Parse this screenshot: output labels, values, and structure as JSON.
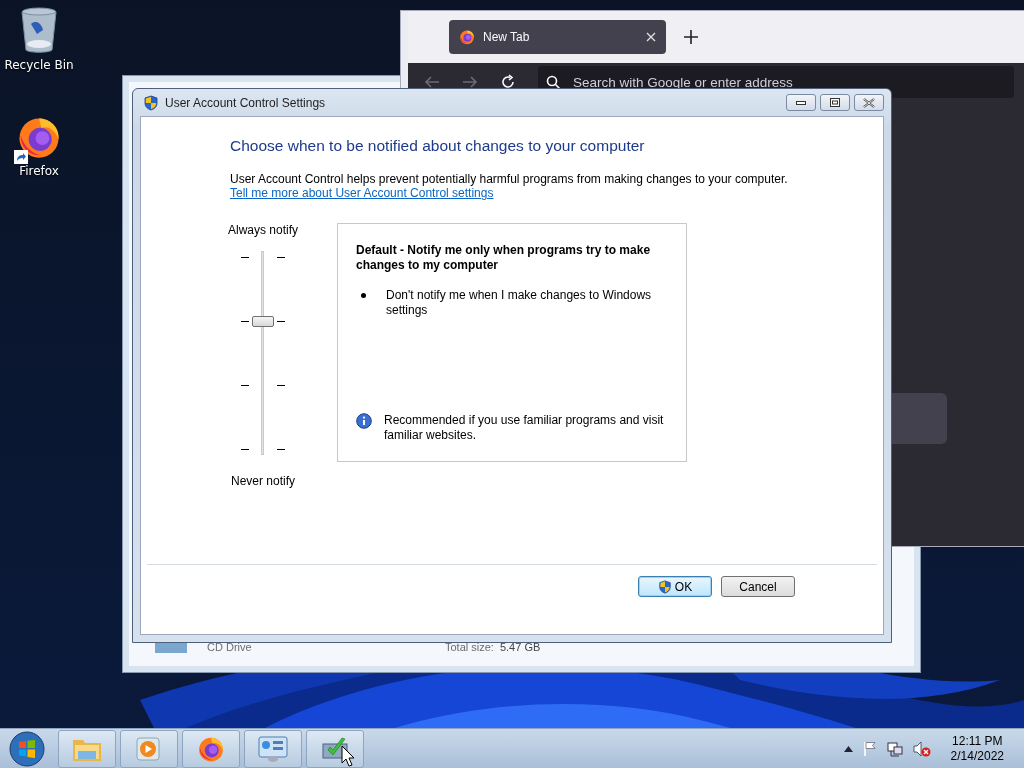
{
  "desktop": {
    "icons": [
      {
        "label": "Recycle Bin",
        "kind": "recycle"
      },
      {
        "label": "Firefox",
        "kind": "firefox"
      }
    ]
  },
  "browser_window": {
    "tabs": [
      {
        "label": "New Tab",
        "selected": true
      }
    ],
    "search": {
      "placeholder": "Search with Google or enter address"
    }
  },
  "explorer_window": {
    "drive": {
      "name": "CD Drive",
      "total_label": "Total size:",
      "total_value": "5.47 GB"
    }
  },
  "dialog": {
    "title": "User Account Control Settings",
    "heading": "Choose when to be notified about changes to your computer",
    "description": "User Account Control helps prevent potentially harmful programs from making changes to your computer.",
    "link": "Tell me more about User Account Control settings",
    "slider": {
      "top_label": "Always notify",
      "bottom_label": "Never notify",
      "level": 0.667
    },
    "info": {
      "title": "Default - Notify me only when programs try to make changes to my computer",
      "bullets": [
        "Don't notify me when I make changes to Windows settings"
      ],
      "recommendation": "Recommended if you use familiar programs and visit familiar websites."
    },
    "buttons": [
      {
        "label": "OK",
        "kind": "primary"
      },
      {
        "label": "Cancel",
        "kind": "normal"
      }
    ]
  },
  "taskbar": {
    "apps": [
      {
        "kind": "explorer"
      },
      {
        "kind": "media"
      },
      {
        "kind": "firefox"
      },
      {
        "kind": "control"
      },
      {
        "kind": "uac"
      }
    ],
    "tray": {
      "muted": true
    },
    "clock": {
      "time": "12:11 PM",
      "date": "2/14/2022"
    }
  }
}
